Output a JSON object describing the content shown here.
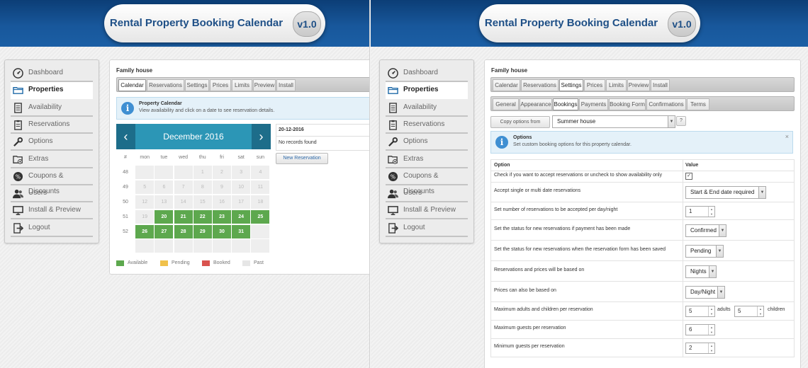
{
  "app": {
    "title": "Rental Property Booking Calendar",
    "version": "v1.0"
  },
  "sidebar": {
    "items": [
      {
        "label": "Dashboard",
        "icon": "dashboard-icon"
      },
      {
        "label": "Properties",
        "icon": "folder-icon"
      },
      {
        "label": "Availability",
        "icon": "document-icon"
      },
      {
        "label": "Reservations",
        "icon": "clipboard-icon"
      },
      {
        "label": "Options",
        "icon": "wrench-icon"
      },
      {
        "label": "Extras",
        "icon": "extras-icon"
      },
      {
        "label": "Coupons & Discounts",
        "icon": "percent-icon"
      },
      {
        "label": "Users",
        "icon": "users-icon"
      },
      {
        "label": "Install & Preview",
        "icon": "monitor-icon"
      },
      {
        "label": "Logout",
        "icon": "logout-icon"
      }
    ],
    "active_index": 1
  },
  "left": {
    "property_name": "Family house",
    "tabs": [
      "Calendar",
      "Reservations",
      "Settings",
      "Prices",
      "Limits",
      "Preview",
      "Install"
    ],
    "active_tab": 0,
    "info": {
      "title": "Property Calendar",
      "text": "View availability and click on a date to see reservation details."
    },
    "calendar": {
      "month_label": "December 2016",
      "prev": "‹",
      "next": "›",
      "week_header": "#",
      "days": [
        "mon",
        "tue",
        "wed",
        "thu",
        "fri",
        "sat",
        "sun"
      ],
      "weeks": [
        {
          "num": "48",
          "days": [
            "",
            "",
            "",
            "1",
            "2",
            "3",
            "4"
          ]
        },
        {
          "num": "49",
          "days": [
            "5",
            "6",
            "7",
            "8",
            "9",
            "10",
            "11"
          ]
        },
        {
          "num": "50",
          "days": [
            "12",
            "13",
            "14",
            "15",
            "16",
            "17",
            "18"
          ]
        },
        {
          "num": "51",
          "days": [
            "19",
            "20",
            "21",
            "22",
            "23",
            "24",
            "25"
          ]
        },
        {
          "num": "52",
          "days": [
            "26",
            "27",
            "28",
            "29",
            "30",
            "31",
            ""
          ]
        },
        {
          "num": "",
          "days": [
            "",
            "",
            "",
            "",
            "",
            "",
            ""
          ]
        }
      ],
      "available_days": [
        "20",
        "21",
        "22",
        "23",
        "24",
        "25",
        "26",
        "27",
        "28",
        "29",
        "30",
        "31"
      ]
    },
    "legend": [
      {
        "label": "Available",
        "color": "#5da84e"
      },
      {
        "label": "Pending",
        "color": "#f0c14b"
      },
      {
        "label": "Booked",
        "color": "#d9534f"
      },
      {
        "label": "Past",
        "color": "#e6e6e6"
      }
    ],
    "selected_date": "20-12-2016",
    "no_records": "No records found",
    "new_reservation": "New Reservation"
  },
  "right": {
    "property_name": "Family house",
    "tabs": [
      "Calendar",
      "Reservations",
      "Settings",
      "Prices",
      "Limits",
      "Preview",
      "Install"
    ],
    "active_tab": 2,
    "subtabs": [
      "General",
      "Appearance",
      "Bookings",
      "Payments",
      "Booking Form",
      "Confirmations",
      "Terms"
    ],
    "active_subtab": 2,
    "copy_button": "Copy options from",
    "copy_select": "Summer house",
    "help": "?",
    "info": {
      "title": "Options",
      "text": "Set custom booking options for this property calendar.",
      "close": "×"
    },
    "table": {
      "col_option": "Option",
      "col_value": "Value",
      "rows": [
        {
          "option": "Check if you want to accept reservations or uncheck to show availability only",
          "type": "check",
          "value": "✓"
        },
        {
          "option": "Accept single or multi date reservations",
          "type": "select",
          "value": "Start & End date required"
        },
        {
          "option": "Set number of reservations to be accepted per day/night",
          "type": "spin",
          "value": "1"
        },
        {
          "option": "Set the status for new reservations if payment has been made",
          "type": "select",
          "value": "Confirmed"
        },
        {
          "option": "Set the status for new reservations when the reservation form has been saved",
          "type": "select",
          "value": "Pending"
        },
        {
          "option": "Reservations and prices will be based on",
          "type": "select",
          "value": "Nights"
        },
        {
          "option": "Prices can also be based on",
          "type": "select",
          "value": "Day/Night"
        },
        {
          "option": "Maximum adults and children per reservation",
          "type": "dual",
          "value": "5",
          "value2": "5",
          "label1": "adults",
          "label2": "children"
        },
        {
          "option": "Maximum guests per reservation",
          "type": "spin",
          "value": "6"
        },
        {
          "option": "Minimum guests per reservation",
          "type": "spin",
          "value": "2"
        }
      ]
    }
  }
}
